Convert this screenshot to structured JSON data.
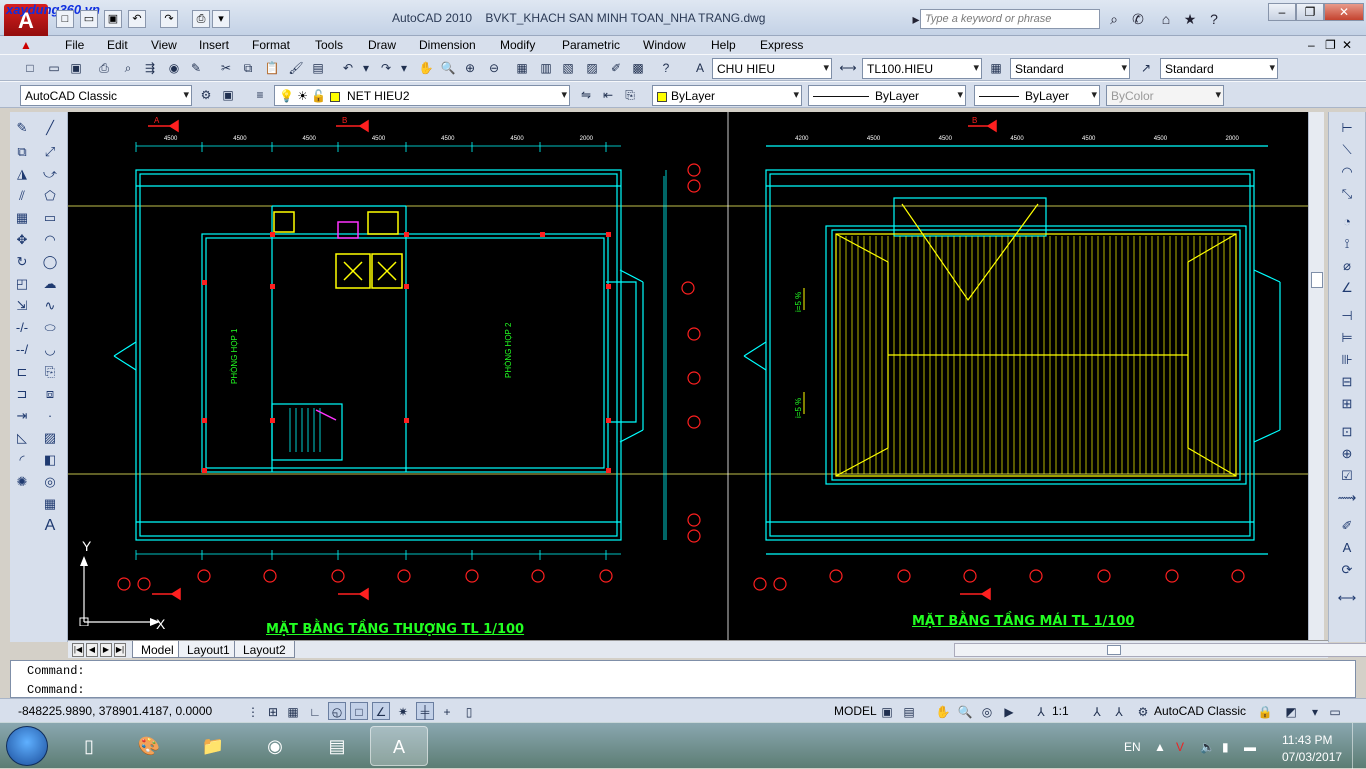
{
  "app": {
    "name": "AutoCAD 2010",
    "document": "BVKT_KHACH SAN MINH TOAN_NHA TRANG.dwg",
    "watermark": "xaydung360.vn"
  },
  "search": {
    "placeholder": "Type a keyword or phrase"
  },
  "menu": [
    "File",
    "Edit",
    "View",
    "Insert",
    "Format",
    "Tools",
    "Draw",
    "Dimension",
    "Modify",
    "Parametric",
    "Window",
    "Help",
    "Express"
  ],
  "styles_toolbar": {
    "text_style": "CHU HIEU",
    "dim_style": "TL100.HIEU",
    "table_style": "Standard",
    "multileader_style": "Standard"
  },
  "layers_toolbar": {
    "workspace": "AutoCAD Classic",
    "current_layer": "NET HIEU2",
    "color": "ByLayer",
    "linetype": "ByLayer",
    "lineweight": "ByLayer",
    "plot_style": "ByColor"
  },
  "drawing": {
    "title_left": "MẶT BẰNG TẦNG THƯỢNG TL 1/100",
    "title_right": "MẶT BẰNG TẦNG MÁI TL 1/100",
    "room_1": "PHÒNG HỌP 1",
    "room_2": "PHÒNG HỌP 2",
    "ucs_x": "X",
    "ucs_y": "Y",
    "section_a": "A",
    "section_b": "B",
    "dims_left": [
      "4500",
      "4500",
      "4500",
      "4500",
      "4500",
      "4500",
      "2000"
    ],
    "dims_right": [
      "4200",
      "4500",
      "4500",
      "4500",
      "4500",
      "4500",
      "2000"
    ],
    "slope_label": "i=5 %"
  },
  "layout_tabs": [
    "Model",
    "Layout1",
    "Layout2"
  ],
  "command": {
    "line1": "Command:",
    "line2": "Command:"
  },
  "status": {
    "coordinates": "-848225.9890, 378901.4187, 0.0000",
    "space": "MODEL",
    "annotation_scale": "1:1",
    "workspace": "AutoCAD Classic"
  },
  "taskbar": {
    "language": "EN",
    "time": "11:43 PM",
    "date": "07/03/2017"
  },
  "colors": {
    "wall": "#00ffff",
    "text": "#22ff22",
    "grid_marker": "#ff2020",
    "hatch": "#ffff00",
    "background": "#000000"
  }
}
